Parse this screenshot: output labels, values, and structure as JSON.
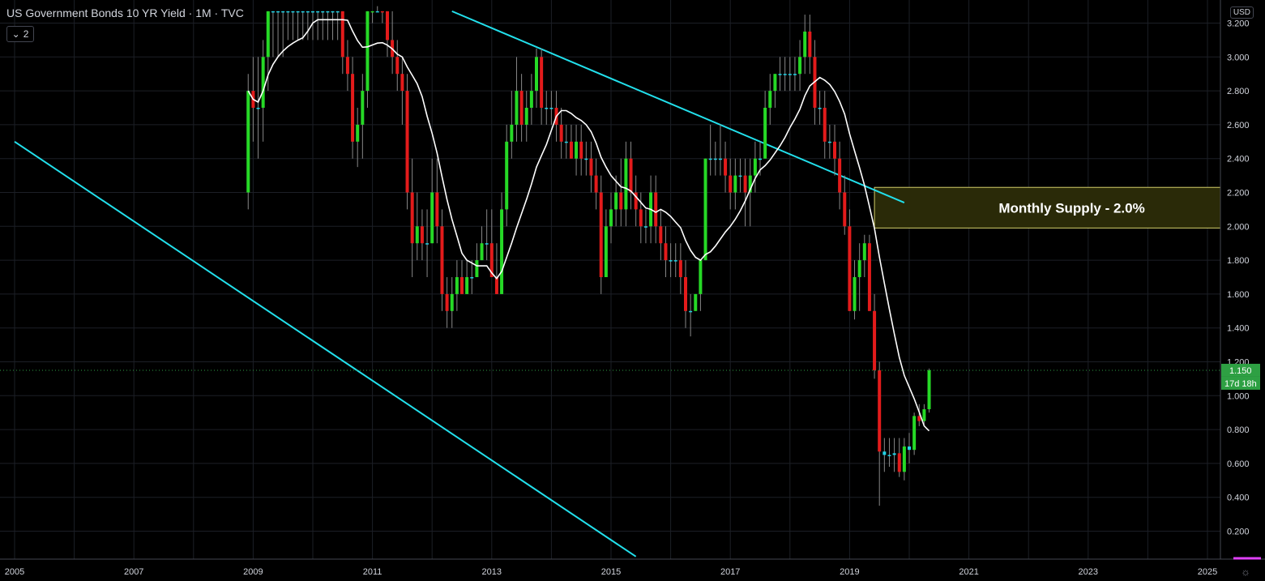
{
  "header": {
    "title": "US Government Bonds 10 YR Yield · 1M · TVC",
    "indicator_count": "2",
    "currency": "USD"
  },
  "colors": {
    "background": "#000000",
    "grid": "#1c1f26",
    "bull": "#26d926",
    "bear": "#e31b1b",
    "doji": "#22d3e6",
    "ma": "#ffffff",
    "trendline": "#22e0ec",
    "supply_fill": "#2a2a08",
    "supply_border": "#d4cf6a",
    "last_price": "#2ea043"
  },
  "chart_data": {
    "type": "candlestick",
    "title": "US Government Bonds 10 YR Yield",
    "interval": "1M",
    "ylim": [
      0.05,
      3.27
    ],
    "xlim": [
      "2005-01",
      "2025-12"
    ],
    "y_ticks": [
      "3.200",
      "3.000",
      "2.800",
      "2.600",
      "2.400",
      "2.200",
      "2.000",
      "1.800",
      "1.600",
      "1.400",
      "1.200",
      "1.000",
      "0.800",
      "0.600",
      "0.400",
      "0.200"
    ],
    "x_ticks": [
      "2005",
      "2007",
      "2009",
      "2011",
      "2013",
      "2015",
      "2017",
      "2019",
      "2021",
      "2023",
      "2025"
    ],
    "last_price": "1.150",
    "countdown": "17d 18h",
    "annotation": {
      "label": "Monthly Supply - 2.0%",
      "y_low": 1.99,
      "y_high": 2.23,
      "x_start": "2019-06",
      "x_end": "2025-12"
    },
    "trendlines": [
      {
        "from": [
          "2005-01",
          2.5
        ],
        "to": [
          "2015-06",
          0.05
        ]
      },
      {
        "from": [
          "2012-05",
          3.27
        ],
        "to": [
          "2019-12",
          2.14
        ]
      }
    ],
    "series": [
      {
        "type": "candles",
        "anchor": "2008-12",
        "values": [
          [
            2.2,
            2.9,
            2.1,
            2.8
          ],
          [
            2.8,
            3.0,
            2.5,
            2.7
          ],
          [
            2.7,
            3.0,
            2.4,
            2.7
          ],
          [
            2.7,
            3.1,
            2.5,
            3.0
          ],
          [
            3.0,
            3.27,
            2.8,
            3.27
          ],
          [
            3.27,
            3.27,
            3.0,
            3.27
          ],
          [
            3.27,
            3.27,
            3.0,
            3.27
          ],
          [
            3.27,
            3.27,
            3.0,
            3.27
          ],
          [
            3.27,
            3.27,
            3.1,
            3.27
          ],
          [
            3.27,
            3.27,
            3.1,
            3.27
          ],
          [
            3.27,
            3.27,
            3.1,
            3.27
          ],
          [
            3.27,
            3.27,
            3.1,
            3.27
          ],
          [
            3.27,
            3.27,
            3.1,
            3.27
          ],
          [
            3.27,
            3.27,
            3.1,
            3.27
          ],
          [
            3.27,
            3.27,
            3.1,
            3.27
          ],
          [
            3.27,
            3.27,
            3.1,
            3.27
          ],
          [
            3.27,
            3.27,
            3.1,
            3.27
          ],
          [
            3.27,
            3.27,
            3.1,
            3.27
          ],
          [
            3.27,
            3.27,
            3.1,
            3.27
          ],
          [
            3.27,
            3.27,
            2.9,
            3.0
          ],
          [
            3.0,
            3.1,
            2.8,
            2.9
          ],
          [
            2.9,
            3.0,
            2.4,
            2.5
          ],
          [
            2.5,
            2.7,
            2.35,
            2.6
          ],
          [
            2.6,
            2.9,
            2.4,
            2.8
          ],
          [
            2.8,
            3.4,
            2.7,
            3.3
          ],
          [
            3.3,
            3.6,
            3.2,
            3.4
          ],
          [
            3.4,
            3.5,
            3.3,
            3.4
          ],
          [
            3.4,
            3.5,
            3.2,
            3.3
          ],
          [
            3.3,
            3.4,
            3.0,
            3.1
          ],
          [
            3.1,
            3.3,
            2.9,
            3.0
          ],
          [
            3.0,
            3.1,
            2.8,
            2.9
          ],
          [
            2.9,
            3.0,
            2.6,
            2.8
          ],
          [
            2.8,
            2.9,
            2.1,
            2.2
          ],
          [
            2.2,
            2.4,
            1.7,
            1.9
          ],
          [
            1.9,
            2.2,
            1.8,
            2.0
          ],
          [
            2.0,
            2.1,
            1.8,
            1.9
          ],
          [
            1.9,
            2.1,
            1.7,
            1.9
          ],
          [
            1.9,
            2.4,
            1.9,
            2.2
          ],
          [
            2.2,
            2.4,
            1.9,
            2.0
          ],
          [
            2.0,
            2.1,
            1.5,
            1.6
          ],
          [
            1.6,
            1.7,
            1.4,
            1.5
          ],
          [
            1.5,
            1.7,
            1.4,
            1.6
          ],
          [
            1.6,
            1.8,
            1.5,
            1.7
          ],
          [
            1.7,
            1.8,
            1.6,
            1.6
          ],
          [
            1.6,
            1.8,
            1.6,
            1.7
          ],
          [
            1.7,
            1.8,
            1.6,
            1.7
          ],
          [
            1.7,
            1.9,
            1.7,
            1.8
          ],
          [
            1.8,
            2.0,
            1.8,
            1.9
          ],
          [
            1.9,
            2.1,
            1.8,
            1.9
          ],
          [
            1.9,
            2.1,
            1.8,
            1.7
          ],
          [
            1.7,
            1.9,
            1.6,
            1.6
          ],
          [
            1.6,
            2.2,
            1.6,
            2.1
          ],
          [
            2.1,
            2.6,
            2.0,
            2.5
          ],
          [
            2.5,
            2.8,
            2.4,
            2.6
          ],
          [
            2.6,
            3.0,
            2.5,
            2.8
          ],
          [
            2.8,
            2.9,
            2.5,
            2.6
          ],
          [
            2.6,
            2.8,
            2.5,
            2.7
          ],
          [
            2.7,
            2.9,
            2.6,
            2.8
          ],
          [
            2.8,
            3.05,
            2.7,
            3.0
          ],
          [
            3.0,
            3.05,
            2.6,
            2.7
          ],
          [
            2.7,
            2.8,
            2.6,
            2.7
          ],
          [
            2.7,
            2.8,
            2.6,
            2.7
          ],
          [
            2.7,
            2.8,
            2.5,
            2.6
          ],
          [
            2.6,
            2.7,
            2.4,
            2.5
          ],
          [
            2.5,
            2.6,
            2.4,
            2.5
          ],
          [
            2.5,
            2.6,
            2.4,
            2.4
          ],
          [
            2.4,
            2.6,
            2.3,
            2.5
          ],
          [
            2.5,
            2.6,
            2.3,
            2.4
          ],
          [
            2.4,
            2.5,
            2.3,
            2.4
          ],
          [
            2.4,
            2.5,
            2.2,
            2.3
          ],
          [
            2.3,
            2.4,
            2.1,
            2.2
          ],
          [
            2.2,
            2.3,
            1.6,
            1.7
          ],
          [
            1.7,
            2.1,
            1.7,
            2.0
          ],
          [
            2.0,
            2.2,
            1.9,
            2.1
          ],
          [
            2.1,
            2.3,
            2.0,
            2.2
          ],
          [
            2.2,
            2.4,
            2.0,
            2.1
          ],
          [
            2.1,
            2.5,
            2.0,
            2.4
          ],
          [
            2.4,
            2.5,
            2.1,
            2.2
          ],
          [
            2.2,
            2.3,
            2.0,
            2.1
          ],
          [
            2.1,
            2.2,
            1.9,
            2.0
          ],
          [
            2.0,
            2.1,
            1.9,
            2.0
          ],
          [
            2.0,
            2.3,
            1.9,
            2.2
          ],
          [
            2.2,
            2.3,
            1.9,
            2.0
          ],
          [
            2.0,
            2.1,
            1.8,
            1.9
          ],
          [
            1.9,
            2.0,
            1.7,
            1.8
          ],
          [
            1.8,
            1.9,
            1.7,
            1.8
          ],
          [
            1.8,
            1.9,
            1.7,
            1.8
          ],
          [
            1.8,
            1.9,
            1.6,
            1.7
          ],
          [
            1.7,
            1.8,
            1.4,
            1.5
          ],
          [
            1.5,
            1.6,
            1.35,
            1.5
          ],
          [
            1.5,
            1.6,
            1.5,
            1.6
          ],
          [
            1.6,
            1.8,
            1.5,
            1.8
          ],
          [
            1.8,
            2.4,
            1.8,
            2.4
          ],
          [
            2.4,
            2.6,
            2.3,
            2.4
          ],
          [
            2.4,
            2.5,
            2.3,
            2.4
          ],
          [
            2.4,
            2.6,
            2.3,
            2.4
          ],
          [
            2.4,
            2.5,
            2.2,
            2.3
          ],
          [
            2.3,
            2.4,
            2.1,
            2.2
          ],
          [
            2.2,
            2.4,
            2.1,
            2.3
          ],
          [
            2.3,
            2.4,
            2.2,
            2.3
          ],
          [
            2.3,
            2.4,
            2.0,
            2.2
          ],
          [
            2.2,
            2.4,
            2.0,
            2.3
          ],
          [
            2.3,
            2.5,
            2.2,
            2.4
          ],
          [
            2.4,
            2.5,
            2.3,
            2.4
          ],
          [
            2.4,
            2.8,
            2.4,
            2.7
          ],
          [
            2.7,
            2.9,
            2.6,
            2.8
          ],
          [
            2.8,
            2.9,
            2.7,
            2.9
          ],
          [
            2.9,
            3.0,
            2.8,
            2.9
          ],
          [
            2.9,
            3.0,
            2.8,
            2.9
          ],
          [
            2.9,
            3.0,
            2.8,
            2.9
          ],
          [
            2.9,
            3.0,
            2.8,
            2.9
          ],
          [
            2.9,
            3.1,
            2.8,
            3.0
          ],
          [
            3.0,
            3.25,
            2.9,
            3.15
          ],
          [
            3.15,
            3.25,
            2.9,
            3.0
          ],
          [
            3.0,
            3.1,
            2.6,
            2.7
          ],
          [
            2.7,
            2.8,
            2.6,
            2.7
          ],
          [
            2.7,
            2.8,
            2.4,
            2.5
          ],
          [
            2.5,
            2.6,
            2.4,
            2.5
          ],
          [
            2.5,
            2.6,
            2.3,
            2.4
          ],
          [
            2.4,
            2.5,
            2.1,
            2.2
          ],
          [
            2.2,
            2.3,
            1.95,
            2.0
          ],
          [
            2.0,
            2.1,
            1.5,
            1.5
          ],
          [
            1.5,
            1.8,
            1.45,
            1.7
          ],
          [
            1.7,
            1.9,
            1.5,
            1.8
          ],
          [
            1.8,
            1.95,
            1.7,
            1.9
          ],
          [
            1.9,
            1.95,
            1.5,
            1.5
          ],
          [
            1.5,
            1.6,
            1.1,
            1.15
          ],
          [
            1.15,
            1.2,
            0.35,
            0.67
          ],
          [
            0.67,
            0.75,
            0.55,
            0.65
          ],
          [
            0.65,
            0.75,
            0.58,
            0.65
          ],
          [
            0.65,
            0.75,
            0.55,
            0.66
          ],
          [
            0.66,
            0.75,
            0.52,
            0.55
          ],
          [
            0.55,
            0.75,
            0.5,
            0.7
          ],
          [
            0.7,
            0.78,
            0.6,
            0.68
          ],
          [
            0.68,
            0.9,
            0.65,
            0.88
          ],
          [
            0.88,
            0.95,
            0.82,
            0.85
          ],
          [
            0.85,
            0.95,
            0.83,
            0.92
          ],
          [
            0.92,
            1.16,
            0.9,
            1.15
          ]
        ]
      },
      {
        "name": "",
        "type": "line",
        "values": [
          3.0,
          3.0,
          3.0
        ]
      }
    ]
  }
}
